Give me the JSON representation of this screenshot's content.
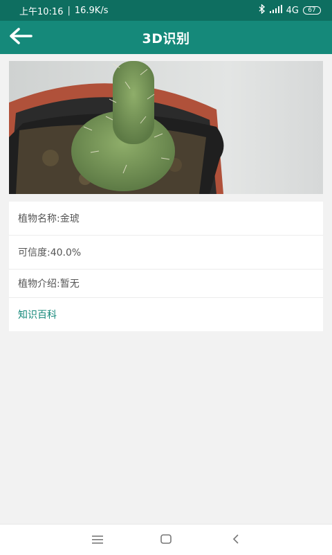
{
  "status_bar": {
    "time": "上午10:16",
    "net_speed": "16.9K/s",
    "network": "4G",
    "battery": "67",
    "icons": [
      "bluetooth-icon",
      "signal-icon",
      "battery-icon"
    ]
  },
  "app_bar": {
    "title": "3D识别",
    "back_icon": "arrow-left-icon"
  },
  "result": {
    "name": "植物名称:金琥",
    "confidence": "可信度:40.0%",
    "intro": "植物介绍:暂无",
    "encyclopedia_link": "知识百科"
  },
  "nav_bar": {
    "icons": [
      "menu-icon",
      "home-icon",
      "back-icon"
    ]
  },
  "colors": {
    "status_bar": "#0e6e60",
    "app_bar": "#15897a",
    "link": "#15897a",
    "background": "#f2f2f2"
  }
}
